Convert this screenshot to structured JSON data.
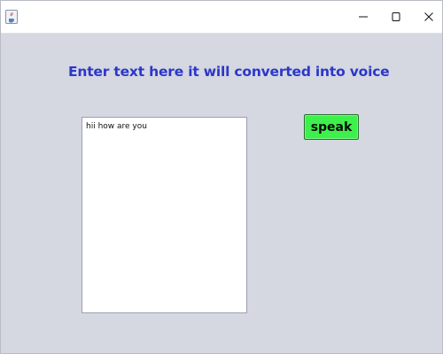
{
  "window": {
    "icon": "java-coffee-cup-icon",
    "controls": {
      "minimize_icon": "minimize-icon",
      "maximize_icon": "maximize-icon",
      "close_icon": "close-icon"
    }
  },
  "main": {
    "heading": "Enter text here it will converted into voice",
    "text_input_value": "hii how are you",
    "speak_button_label": "speak"
  },
  "colors": {
    "background": "#d5d7e1",
    "heading": "#2b37c9",
    "speak_button": "#3ef04b"
  }
}
